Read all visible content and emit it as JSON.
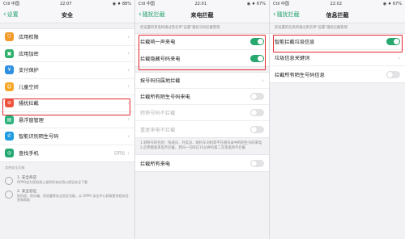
{
  "status": {
    "p1": {
      "carrier": "Ctil 中国",
      "time": "22:07",
      "battery": "◉ ♦ 88%"
    },
    "p2": {
      "carrier": "Ctil 中国",
      "time": "22:01",
      "battery": "◉ ♦ 67%"
    },
    "p3": {
      "carrier": "Ctil 中国",
      "time": "22:02",
      "battery": "◉ ♦ 67%"
    }
  },
  "panel1": {
    "back": "设置",
    "title": "安全",
    "items": [
      {
        "label": "应用权限",
        "icon": "shield-icon",
        "color": "#f39a2b",
        "glyph": "⛉"
      },
      {
        "label": "应用加密",
        "icon": "lock-icon",
        "color": "#2fb06b",
        "glyph": "▣"
      },
      {
        "label": "支付保护",
        "icon": "payment-icon",
        "color": "#2f8fe0",
        "glyph": "¥"
      },
      {
        "label": "儿童空间",
        "icon": "child-icon",
        "color": "#f6a623",
        "glyph": "☺"
      },
      {
        "label": "骚扰拦截",
        "icon": "block-icon",
        "color": "#f0533c",
        "glyph": "⊘"
      },
      {
        "label": "悬浮窗管理",
        "icon": "window-icon",
        "color": "#2bb27a",
        "glyph": "▤"
      },
      {
        "label": "智能识别陌生号码",
        "icon": "phone-icon",
        "color": "#1e9be0",
        "glyph": "✆"
      },
      {
        "label": "查找手机",
        "icon": "find-icon",
        "color": "#23a871",
        "glyph": "◎",
        "value": "已开启"
      }
    ],
    "footer_title": "其他安全功能",
    "security": [
      {
        "title": "1. 安全商店",
        "text": "OPPO会为您检测上架的所有应用以保证安全下载"
      },
      {
        "title": "2. 安全验证",
        "text": "防伪造、防诈骗、防泄露等安全验证功能，从 OPPO 安全中心获取更多相关信息和帮助"
      }
    ]
  },
  "panel2": {
    "back": "骚扰拦截",
    "title": "来电拦截",
    "note": "您设置的来电将通过黑名单\"设置\"骚扰号码拦截管理",
    "toggles": [
      {
        "label": "拦截响一声来电",
        "state": "on"
      },
      {
        "label": "拦截隐藏号码来电",
        "state": "on"
      }
    ],
    "group2": [
      {
        "label": "按号码归属地拦截",
        "type": "arrow"
      },
      {
        "label": "拦截所有陌生号码来电",
        "type": "toggle",
        "state": "off"
      },
      {
        "label": "转移号码不拦截",
        "type": "toggle",
        "state": "off",
        "disabled": true
      },
      {
        "label": "重复来电不拦截",
        "type": "toggle",
        "state": "off",
        "disabled": true
      }
    ],
    "explain": "1.转移号码包括：快递员、外卖员、网约车司机等不在通讯录中的陌生号码来电\n2.启用重复来电不拦截，若同一号码在15分钟内第二次来电将不拦截",
    "group3": [
      {
        "label": "拦截所有来电",
        "type": "toggle",
        "state": "off"
      }
    ]
  },
  "panel3": {
    "back": "骚扰拦截",
    "title": "信息拦截",
    "note": "您设置的信息将通过黑名单\"设置\"骚扰拦截管理",
    "rows": [
      {
        "label": "智能拦截垃圾信息",
        "type": "toggle",
        "state": "on"
      },
      {
        "label": "垃圾信息关键词",
        "type": "arrow"
      },
      {
        "label": "拦截所有陌生号码信息",
        "type": "toggle",
        "state": "off"
      }
    ]
  }
}
